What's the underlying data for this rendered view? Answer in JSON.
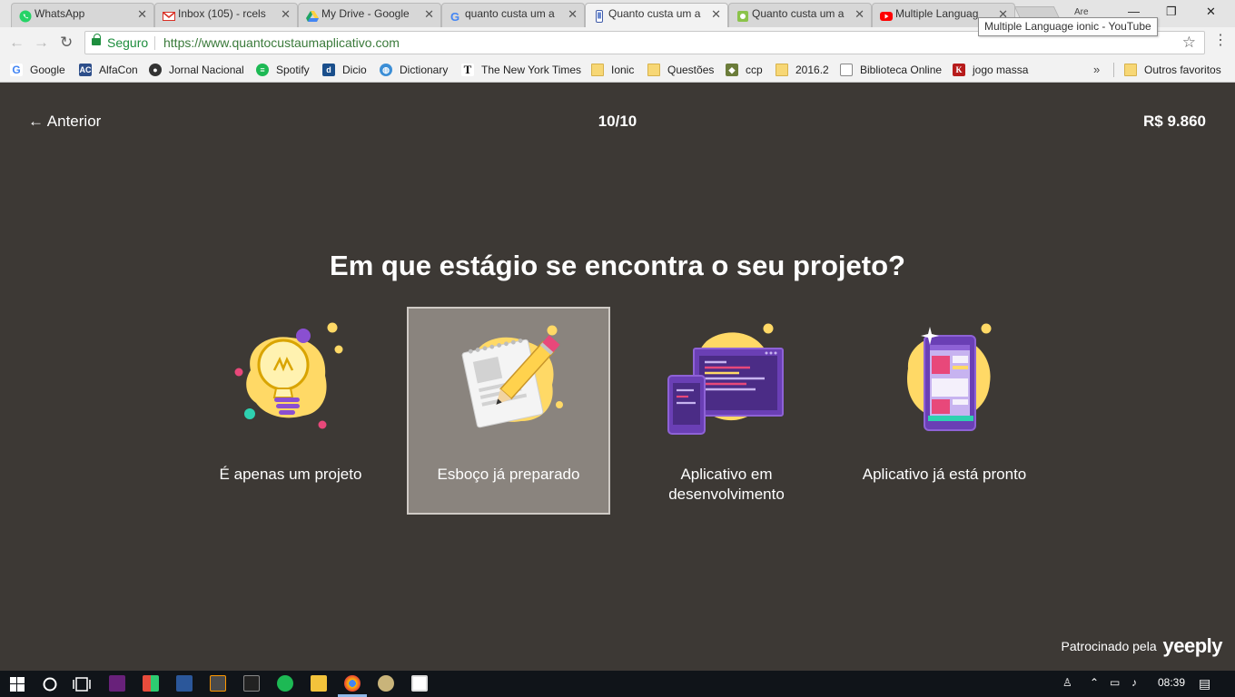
{
  "browser": {
    "tabs": [
      {
        "title": "WhatsApp",
        "icon": "whatsapp-icon",
        "color": "#25d366",
        "active": false
      },
      {
        "title": "Inbox (105) - rcels",
        "icon": "gmail-icon",
        "color": "#d93025",
        "active": false
      },
      {
        "title": "My Drive - Google",
        "icon": "drive-icon",
        "color": "#1fa463",
        "active": false
      },
      {
        "title": "quanto custa um a",
        "icon": "google-icon",
        "color": "#4285f4",
        "active": false
      },
      {
        "title": "Quanto custa um a",
        "icon": "phone-icon",
        "color": "#5b6ea8",
        "active": true
      },
      {
        "title": "Quanto custa um a",
        "icon": "puzzle-icon",
        "color": "#8bc34a",
        "active": false
      },
      {
        "title": "Multiple Languag",
        "icon": "youtube-icon",
        "color": "#ff0000",
        "active": false
      }
    ],
    "tooltip": "Multiple Language ionic - YouTube",
    "profile_label": "Are",
    "security_label": "Seguro",
    "url": "https://www.quantocustaumaplicativo.com",
    "bookmarks": [
      {
        "label": "Google",
        "icon": "google-icon",
        "color": "#4285f4"
      },
      {
        "label": "AlfaCon",
        "icon": "alfacon-icon",
        "color": "#2d4e8a"
      },
      {
        "label": "Jornal Nacional",
        "icon": "globo-icon",
        "color": "#333333"
      },
      {
        "label": "Spotify",
        "icon": "spotify-icon",
        "color": "#1db954"
      },
      {
        "label": "Dicio",
        "icon": "dicio-icon",
        "color": "#1a4f8c"
      },
      {
        "label": "Dictionary",
        "icon": "globe-icon",
        "color": "#3b8ed6"
      },
      {
        "label": "The New York Times",
        "icon": "nyt-icon",
        "color": "#111111"
      },
      {
        "label": "Ionic",
        "icon": "folder-icon",
        "color": "#f7d775"
      },
      {
        "label": "Questões",
        "icon": "folder-icon",
        "color": "#f7d775"
      },
      {
        "label": "ccp",
        "icon": "crest-icon",
        "color": "#6b7c3a"
      },
      {
        "label": "2016.2",
        "icon": "folder-icon",
        "color": "#f7d775"
      },
      {
        "label": "Biblioteca Online",
        "icon": "page-icon",
        "color": "#ffffff"
      },
      {
        "label": "jogo massa",
        "icon": "k-icon",
        "color": "#b71c1c"
      }
    ],
    "bookmarks_overflow": "»",
    "other_bookmarks": "Outros favoritos"
  },
  "page": {
    "back_label": "← Anterior",
    "step": "10/10",
    "price": "R$ 9.860",
    "question": "Em que estágio se encontra o seu projeto?",
    "options": [
      {
        "label": "É apenas um projeto",
        "icon": "lightbulb-icon",
        "selected": false
      },
      {
        "label": "Esboço já preparado",
        "icon": "sketch-notepad-icon",
        "selected": true
      },
      {
        "label": "Aplicativo em desenvolvimento",
        "icon": "devices-code-icon",
        "selected": false
      },
      {
        "label": "Aplicativo já está pronto",
        "icon": "finished-app-icon",
        "selected": false
      }
    ],
    "sponsor_text": "Patrocinado pela",
    "sponsor_brand": "yeeply",
    "colors": {
      "background": "#3d3935",
      "selected_card": "#8a847e",
      "accent_yellow": "#ffd966",
      "accent_purple": "#6a3fb5"
    }
  },
  "taskbar": {
    "time": "08:39",
    "apps": [
      "start-icon",
      "search-icon",
      "task-view-icon",
      "visual-studio-icon",
      "paint-icon",
      "word-icon",
      "sublime-icon",
      "cmd-icon",
      "spotify-icon",
      "file-explorer-icon",
      "chrome-icon",
      "paint-brush-icon",
      "photos-icon"
    ]
  }
}
